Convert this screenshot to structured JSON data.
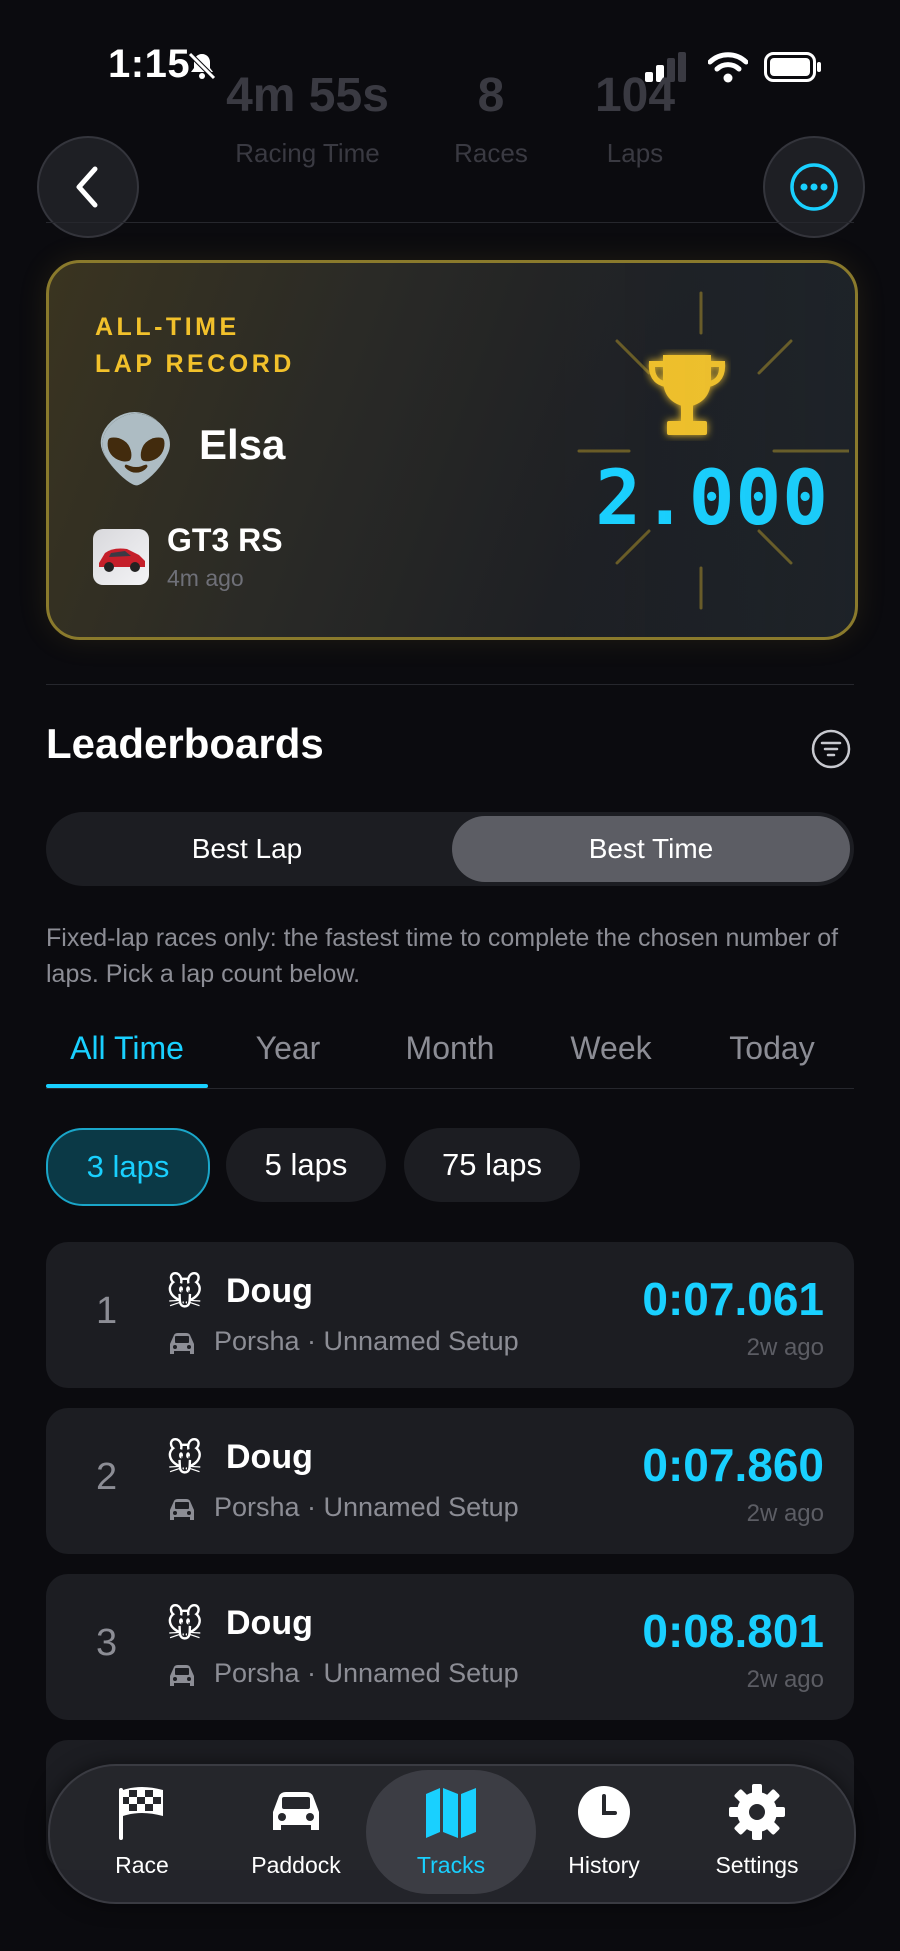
{
  "status_bar": {
    "time": "1:15"
  },
  "header_stats": [
    {
      "value": "4m 55s",
      "label": "Racing Time"
    },
    {
      "value": "8",
      "label": "Races"
    },
    {
      "value": "104",
      "label": "Laps"
    }
  ],
  "record": {
    "label": "ALL-TIME\nLAP RECORD",
    "emoji": "👽",
    "driver": "Elsa",
    "car": "GT3 RS",
    "ago": "4m ago",
    "time": "2.000"
  },
  "leaderboards": {
    "title": "Leaderboards",
    "segments": [
      "Best Lap",
      "Best Time"
    ],
    "selected_segment": "Best Time",
    "description": "Fixed-lap races only: the fastest time to complete the chosen number of laps. Pick a lap count below.",
    "periods": [
      "All Time",
      "Year",
      "Month",
      "Week",
      "Today"
    ],
    "selected_period": "All Time",
    "lap_chips": [
      "3 laps",
      "5 laps",
      "75 laps"
    ],
    "selected_chip": "3 laps",
    "rows": [
      {
        "rank": "1",
        "avatar": "🐭",
        "driver": "Doug",
        "setup": "Porsha · Unnamed Setup",
        "time": "0:07.061",
        "ago": "2w ago"
      },
      {
        "rank": "2",
        "avatar": "🐭",
        "driver": "Doug",
        "setup": "Porsha · Unnamed Setup",
        "time": "0:07.860",
        "ago": "2w ago"
      },
      {
        "rank": "3",
        "avatar": "🐭",
        "driver": "Doug",
        "setup": "Porsha · Unnamed Setup",
        "time": "0:08.801",
        "ago": "2w ago"
      }
    ]
  },
  "nav": {
    "items": [
      "Race",
      "Paddock",
      "Tracks",
      "History",
      "Settings"
    ],
    "active": "Tracks"
  },
  "colors": {
    "accent": "#19d0ff",
    "gold": "#f2c12b",
    "background": "#0b0b0f",
    "card": "#1c1d22"
  }
}
